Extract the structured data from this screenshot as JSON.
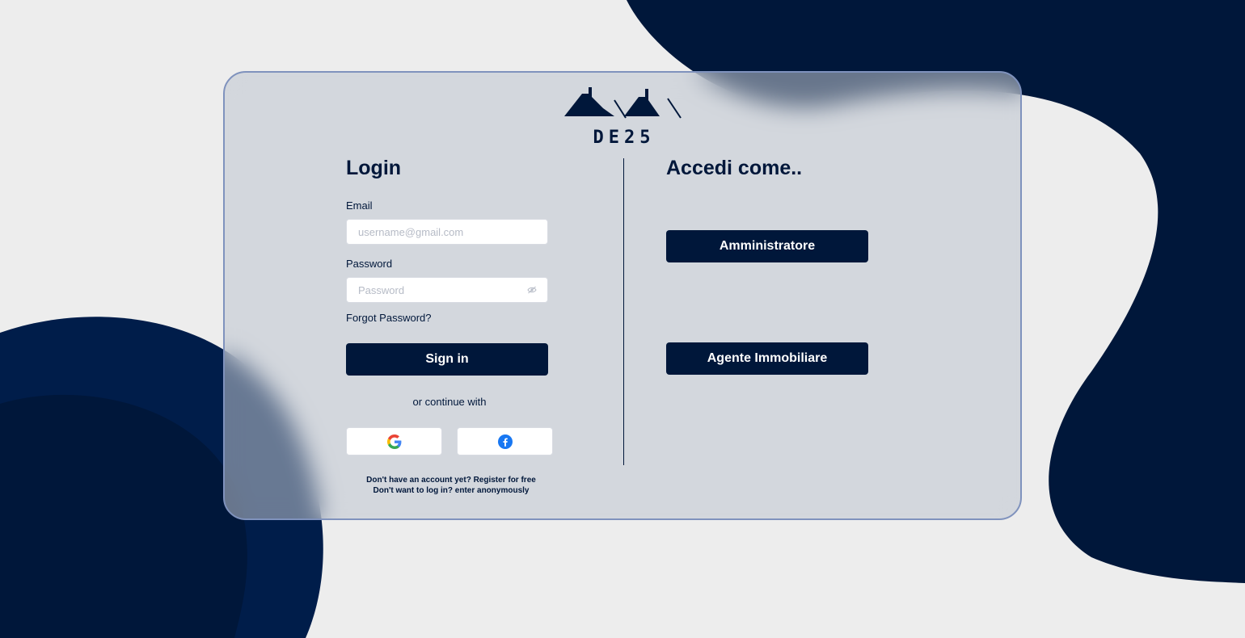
{
  "brand": {
    "name": "DE25"
  },
  "colors": {
    "primary": "#00173a",
    "background": "#ededed",
    "card_border": "#7f92bd",
    "google_blue": "#4285F4",
    "google_red": "#EA4335",
    "google_yellow": "#FBBC05",
    "google_green": "#34A853",
    "facebook_blue": "#1877F2"
  },
  "login": {
    "title": "Login",
    "email_label": "Email",
    "email_placeholder": "username@gmail.com",
    "password_label": "Password",
    "password_placeholder": "Password",
    "forgot_password": "Forgot Password?",
    "sign_in": "Sign in",
    "continue_with": "or continue with",
    "social": [
      {
        "name": "google",
        "icon": "google-icon"
      },
      {
        "name": "facebook",
        "icon": "facebook-icon"
      }
    ],
    "register_prompt": "Don't have an account yet? Register for free",
    "anonymous_prompt": "Don't want to log in? enter anonymously"
  },
  "roles": {
    "title": "Accedi come..",
    "admin_label": "Amministratore",
    "agent_label": "Agente Immobiliare"
  }
}
